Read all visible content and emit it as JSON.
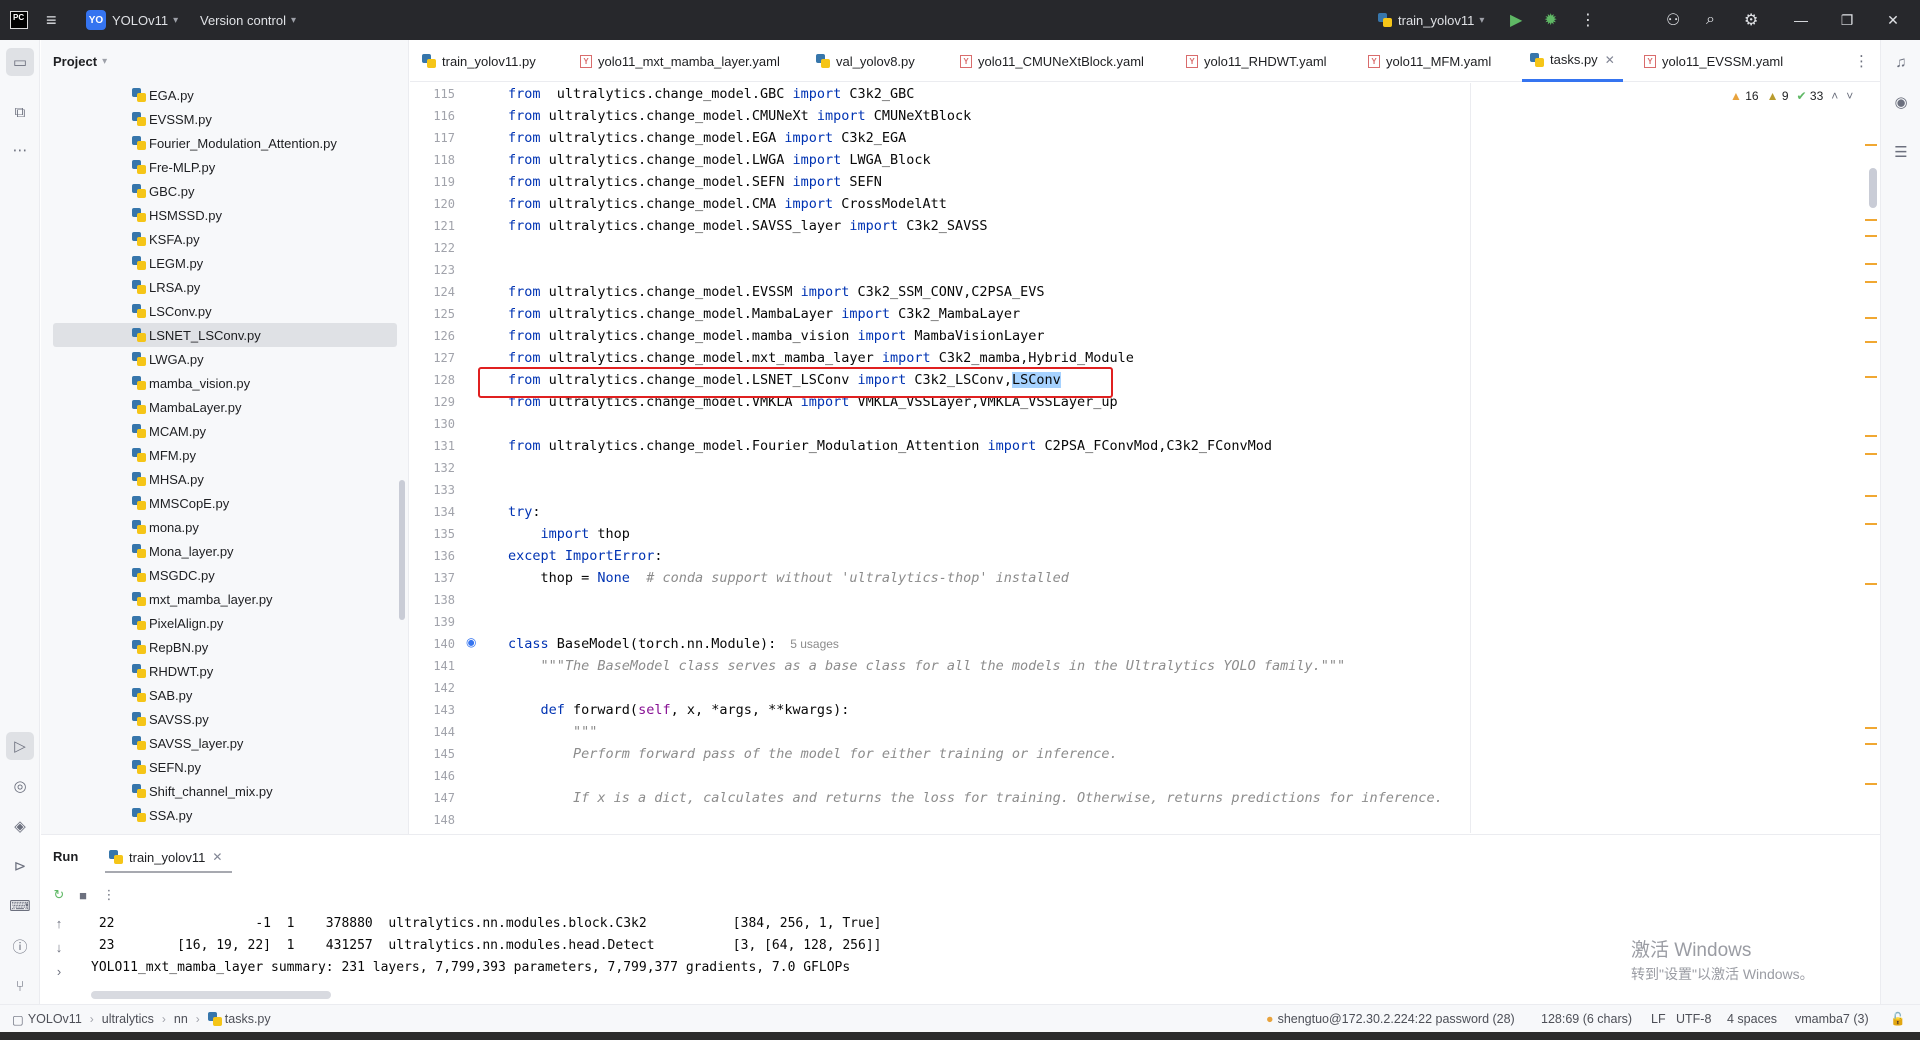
{
  "window": {
    "project_name": "YOLOv11",
    "project_badge": "YO",
    "vcs_label": "Version control",
    "run_config": "train_yolov11"
  },
  "project_panel": {
    "title": "Project",
    "files": [
      "EGA.py",
      "EVSSM.py",
      "Fourier_Modulation_Attention.py",
      "Fre-MLP.py",
      "GBC.py",
      "HSMSSD.py",
      "KSFA.py",
      "LEGM.py",
      "LRSA.py",
      "LSConv.py",
      "LSNET_LSConv.py",
      "LWGA.py",
      "mamba_vision.py",
      "MambaLayer.py",
      "MCAM.py",
      "MFM.py",
      "MHSA.py",
      "MMSCopE.py",
      "mona.py",
      "Mona_layer.py",
      "MSGDC.py",
      "mxt_mamba_layer.py",
      "PixelAlign.py",
      "RepBN.py",
      "RHDWT.py",
      "SAB.py",
      "SAVSS.py",
      "SAVSS_layer.py",
      "SEFN.py",
      "Shift_channel_mix.py",
      "SSA.py"
    ],
    "selected_file": "LSNET_LSConv.py"
  },
  "tabs": [
    {
      "label": "train_yolov11.py",
      "type": "py"
    },
    {
      "label": "yolo11_mxt_mamba_layer.yaml",
      "type": "yaml"
    },
    {
      "label": "val_yolov8.py",
      "type": "py"
    },
    {
      "label": "yolo11_CMUNeXtBlock.yaml",
      "type": "yaml"
    },
    {
      "label": "yolo11_RHDWT.yaml",
      "type": "yaml"
    },
    {
      "label": "yolo11_MFM.yaml",
      "type": "yaml"
    },
    {
      "label": "tasks.py",
      "type": "py",
      "active": true
    },
    {
      "label": "yolo11_EVSSM.yaml",
      "type": "yaml"
    }
  ],
  "inspections": {
    "warnings": "16",
    "weak_warnings": "9",
    "ok": "33"
  },
  "editor": {
    "lines": [
      {
        "n": "115",
        "segs": [
          [
            "kw",
            "from"
          ],
          [
            "",
            "  ultralytics.change_model.GBC "
          ],
          [
            "kw",
            "import"
          ],
          [
            "",
            " C3k2_GBC"
          ]
        ]
      },
      {
        "n": "116",
        "segs": [
          [
            "kw",
            "from"
          ],
          [
            "",
            " ultralytics.change_model.CMUNeXt "
          ],
          [
            "kw",
            "import"
          ],
          [
            "",
            " CMUNeXtBlock"
          ]
        ]
      },
      {
        "n": "117",
        "segs": [
          [
            "kw",
            "from"
          ],
          [
            "",
            " ultralytics.change_model.EGA "
          ],
          [
            "kw",
            "import"
          ],
          [
            "",
            " C3k2_EGA"
          ]
        ]
      },
      {
        "n": "118",
        "segs": [
          [
            "kw",
            "from"
          ],
          [
            "",
            " ultralytics.change_model.LWGA "
          ],
          [
            "kw",
            "import"
          ],
          [
            "",
            " LWGA_Block"
          ]
        ]
      },
      {
        "n": "119",
        "segs": [
          [
            "kw",
            "from"
          ],
          [
            "",
            " ultralytics.change_model.SEFN "
          ],
          [
            "kw",
            "import"
          ],
          [
            "",
            " SEFN"
          ]
        ]
      },
      {
        "n": "120",
        "segs": [
          [
            "kw",
            "from"
          ],
          [
            "",
            " ultralytics.change_model.CMA "
          ],
          [
            "kw",
            "import"
          ],
          [
            "",
            " CrossModelAtt"
          ]
        ]
      },
      {
        "n": "121",
        "segs": [
          [
            "kw",
            "from"
          ],
          [
            "",
            " ultralytics.change_model.SAVSS_layer "
          ],
          [
            "kw",
            "import"
          ],
          [
            "",
            " C3k2_SAVSS"
          ]
        ]
      },
      {
        "n": "122",
        "segs": []
      },
      {
        "n": "123",
        "segs": []
      },
      {
        "n": "124",
        "segs": [
          [
            "kw",
            "from"
          ],
          [
            "",
            " ultralytics.change_model.EVSSM "
          ],
          [
            "kw",
            "import"
          ],
          [
            "",
            " C3k2_SSM_CONV,C2PSA_EVS"
          ]
        ]
      },
      {
        "n": "125",
        "segs": [
          [
            "kw",
            "from"
          ],
          [
            "",
            " ultralytics.change_model.MambaLayer "
          ],
          [
            "kw",
            "import"
          ],
          [
            "",
            " C3k2_MambaLayer"
          ]
        ]
      },
      {
        "n": "126",
        "segs": [
          [
            "kw",
            "from"
          ],
          [
            "",
            " ultralytics.change_model.mamba_vision "
          ],
          [
            "kw",
            "import"
          ],
          [
            "",
            " MambaVisionLayer"
          ]
        ]
      },
      {
        "n": "127",
        "segs": [
          [
            "kw",
            "from"
          ],
          [
            "",
            " ultralytics.change_model.mxt_mamba_layer "
          ],
          [
            "kw",
            "import"
          ],
          [
            "",
            " C3k2_mamba,Hybrid_Module"
          ]
        ]
      },
      {
        "n": "128",
        "segs": [
          [
            "kw",
            "from"
          ],
          [
            "",
            " ultralytics.change_model.LSNET_LSConv "
          ],
          [
            "kw",
            "import"
          ],
          [
            "",
            " C3k2_LSConv,"
          ],
          [
            "sel",
            "LSConv"
          ]
        ]
      },
      {
        "n": "129",
        "segs": [
          [
            "kw",
            "from"
          ],
          [
            "",
            " ultralytics.change_model.VMKLA "
          ],
          [
            "kw",
            "import"
          ],
          [
            "",
            " VMKLA_VSSLayer,VMKLA_VSSLayer_up"
          ]
        ]
      },
      {
        "n": "130",
        "segs": []
      },
      {
        "n": "131",
        "segs": [
          [
            "kw",
            "from"
          ],
          [
            "",
            " ultralytics.change_model.Fourier_Modulation_Attention "
          ],
          [
            "kw",
            "import"
          ],
          [
            "",
            " C2PSA_FConvMod,C3k2_FConvMod"
          ]
        ]
      },
      {
        "n": "132",
        "segs": []
      },
      {
        "n": "133",
        "segs": []
      },
      {
        "n": "134",
        "segs": [
          [
            "kw",
            "try"
          ],
          [
            "",
            ":"
          ]
        ]
      },
      {
        "n": "135",
        "segs": [
          [
            "",
            "    "
          ],
          [
            "kw",
            "import"
          ],
          [
            "",
            " thop"
          ]
        ]
      },
      {
        "n": "136",
        "segs": [
          [
            "kw",
            "except"
          ],
          [
            "",
            " "
          ],
          [
            "kw",
            "ImportError"
          ],
          [
            "",
            ":"
          ]
        ]
      },
      {
        "n": "137",
        "segs": [
          [
            "",
            "    thop = "
          ],
          [
            "kw",
            "None"
          ],
          [
            "",
            "  "
          ],
          [
            "cm",
            "# conda support without 'ultralytics-thop' installed"
          ]
        ]
      },
      {
        "n": "138",
        "segs": []
      },
      {
        "n": "139",
        "segs": []
      },
      {
        "n": "140",
        "segs": [
          [
            "kw",
            "class"
          ],
          [
            "",
            " BaseModel(torch.nn.Module):"
          ],
          [
            "usage",
            "5 usages"
          ]
        ]
      },
      {
        "n": "141",
        "segs": [
          [
            "",
            "    "
          ],
          [
            "doc",
            "\"\"\"The BaseModel class serves as a base class for all the models in the Ultralytics YOLO family.\"\"\""
          ]
        ]
      },
      {
        "n": "142",
        "segs": []
      },
      {
        "n": "143",
        "segs": [
          [
            "",
            "    "
          ],
          [
            "kw",
            "def"
          ],
          [
            "",
            " forward("
          ],
          [
            "kw2",
            "self"
          ],
          [
            "",
            ", x, *args, **kwargs):"
          ]
        ]
      },
      {
        "n": "144",
        "segs": [
          [
            "",
            "        "
          ],
          [
            "doc",
            "\"\"\""
          ]
        ]
      },
      {
        "n": "145",
        "segs": [
          [
            "",
            "        "
          ],
          [
            "doc",
            "Perform forward pass of the model for either training or inference."
          ]
        ]
      },
      {
        "n": "146",
        "segs": []
      },
      {
        "n": "147",
        "segs": [
          [
            "",
            "        "
          ],
          [
            "doc",
            "If x is a dict, calculates and returns the loss for training. Otherwise, returns predictions for inference."
          ]
        ]
      },
      {
        "n": "148",
        "segs": []
      }
    ]
  },
  "run_panel": {
    "title": "Run",
    "tab_label": "train_yolov11",
    "output": [
      " 22                  -1  1    378880  ultralytics.nn.modules.block.C3k2           [384, 256, 1, True]",
      " 23        [16, 19, 22]  1    431257  ultralytics.nn.modules.head.Detect          [3, [64, 128, 256]]",
      "YOLO11_mxt_mamba_layer summary: 231 layers, 7,799,393 parameters, 7,799,377 gradients, 7.0 GFLOPs"
    ]
  },
  "watermark": {
    "line1": "激活 Windows",
    "line2": "转到\"设置\"以激活 Windows。"
  },
  "statusbar": {
    "breadcrumb": [
      "YOLOv11",
      "ultralytics",
      "nn",
      "tasks.py"
    ],
    "remote": "shengtuo@172.30.2.224:22 password (28)",
    "position": "128:69 (6 chars)",
    "line_sep": "LF",
    "encoding": "UTF-8",
    "indent": "4 spaces",
    "interpreter": "vmamba7 (3)"
  }
}
